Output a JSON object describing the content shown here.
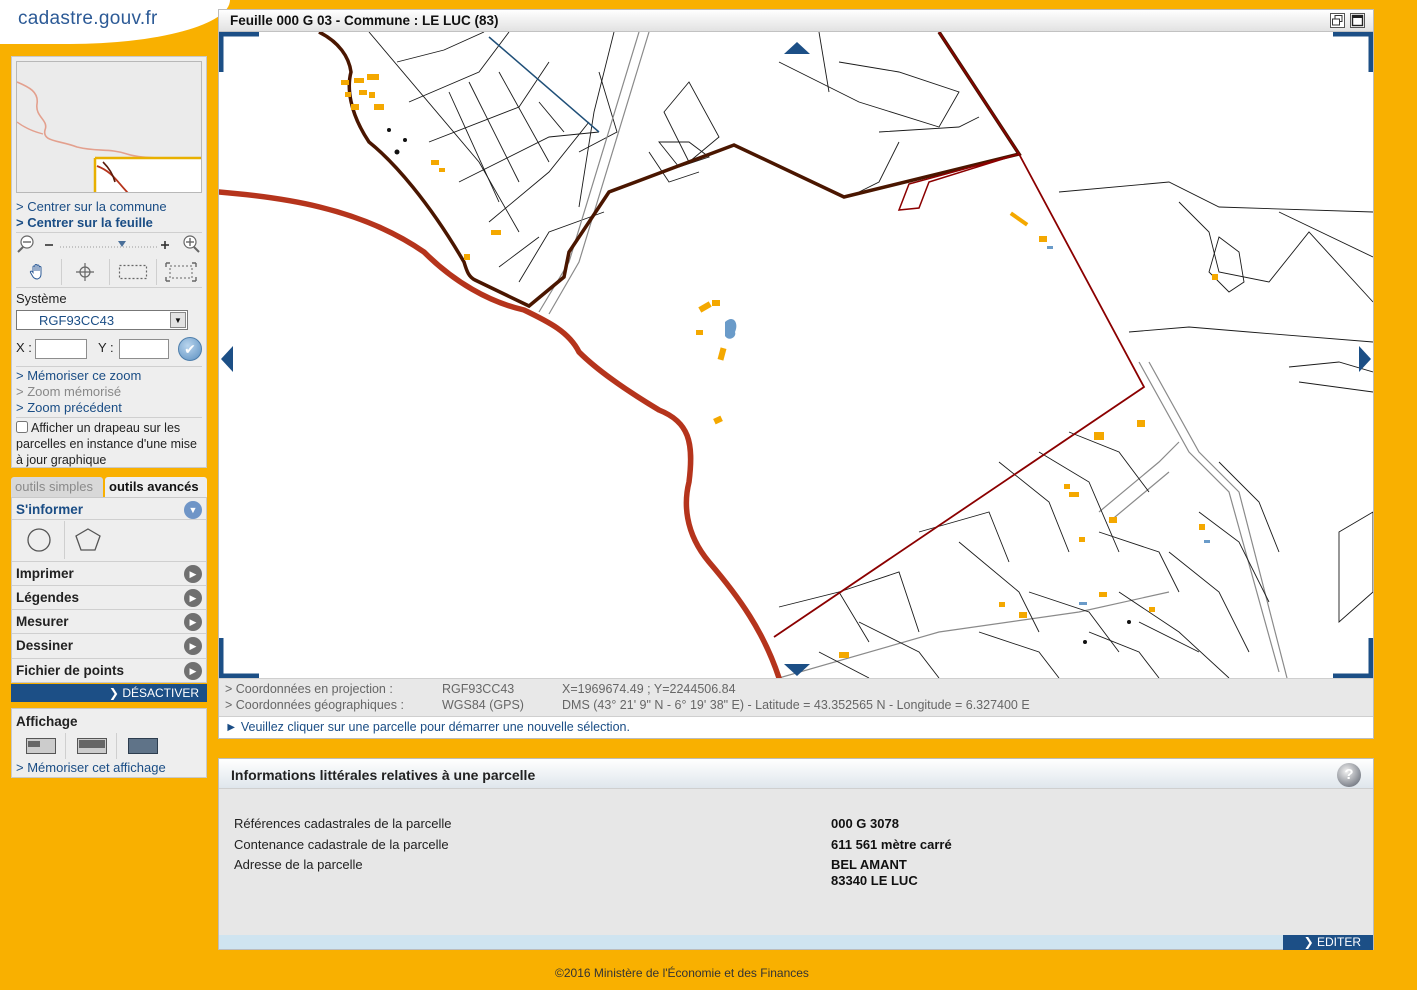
{
  "logo": {
    "text": "cadastre.gouv.fr"
  },
  "sidebar": {
    "center_commune": "> Centrer sur la commune",
    "center_feuille": "> Centrer sur la feuille",
    "systeme_label": "Système",
    "systeme_value": "RGF93CC43",
    "x_label": "X :",
    "y_label": "Y :",
    "x_value": "",
    "y_value": "",
    "memoriser_zoom": "> Mémoriser ce zoom",
    "zoom_memorise": "> Zoom mémorisé",
    "zoom_precedent": "> Zoom précédent",
    "flag_checkbox_label": "Afficher un drapeau sur les parcelles en instance d'une mise à jour graphique"
  },
  "tabs": {
    "simple": "outils simples",
    "advanced": "outils avancés"
  },
  "tools": {
    "sinformer": "S'informer",
    "items": [
      "Imprimer",
      "Légendes",
      "Mesurer",
      "Dessiner",
      "Fichier de points"
    ],
    "deactivate": "DÉSACTIVER"
  },
  "affichage": {
    "title": "Affichage",
    "memoriser": "> Mémoriser cet affichage"
  },
  "map_window": {
    "title": "Feuille 000 G 03 - Commune : LE LUC (83)",
    "coords_projection_label": "> Coordonnées en projection :",
    "coords_projection_system": "RGF93CC43",
    "coords_projection_value": "X=1969674.49 ; Y=2244506.84",
    "coords_geo_label": "> Coordonnées géographiques :",
    "coords_geo_system": "WGS84 (GPS)",
    "coords_geo_value": "DMS (43° 21' 9\" N - 6° 19' 38\" E) - Latitude = 43.352565 N - Longitude = 6.327400 E",
    "notice": "► Veuillez cliquer sur une parcelle pour démarrer une nouvelle sélection."
  },
  "info_panel": {
    "title": "Informations littérales relatives à une parcelle",
    "help": "?",
    "references_label": "Références cadastrales de la parcelle",
    "references_value": "000 G 3078",
    "contenance_label": "Contenance cadastrale de la parcelle",
    "contenance_value": "611 561 mètre carré",
    "adresse_label": "Adresse de la parcelle",
    "adresse_line1": "BEL AMANT",
    "adresse_line2": "83340 LE LUC",
    "edit_button": "EDITER"
  },
  "footer": {
    "copyright": "©2016 Ministère de l'Économie et des Finances"
  },
  "colors": {
    "background": "#f9b000",
    "link_blue": "#1a4d85",
    "parcel_border": "#8b0000",
    "commune_border": "#b5341c",
    "building": "#f4a800"
  }
}
